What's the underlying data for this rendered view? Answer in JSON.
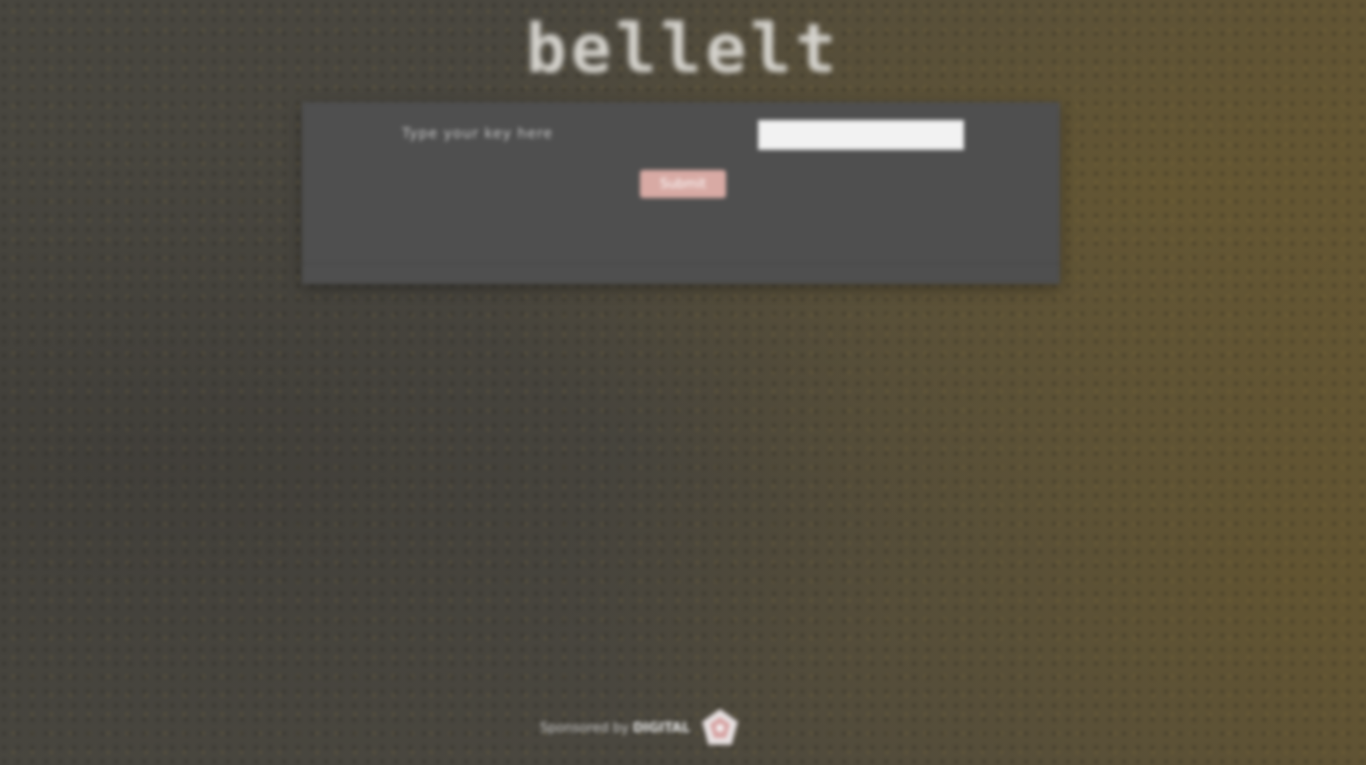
{
  "header": {
    "logo_text": "bellelt"
  },
  "form": {
    "label": "Type your key here",
    "input_value": "",
    "input_placeholder": "",
    "submit_label": "Submit"
  },
  "footer": {
    "prefix": "Sponsored by",
    "brand": "DIGITAL",
    "icon": "badge-icon"
  },
  "colors": {
    "panel": "#4f4f4f",
    "button": "#d8aaa4",
    "logo": "#d4d2cc"
  }
}
